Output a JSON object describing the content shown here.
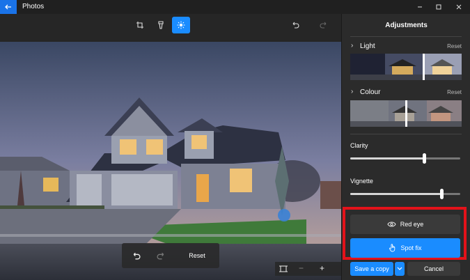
{
  "app": {
    "title": "Photos"
  },
  "overlay": {
    "reset_label": "Reset"
  },
  "panel": {
    "title": "Adjustments",
    "light": {
      "label": "Light",
      "reset": "Reset",
      "marker": 0.65
    },
    "colour": {
      "label": "Colour",
      "reset": "Reset",
      "marker": 0.5
    },
    "clarity": {
      "label": "Clarity",
      "value": 0.67
    },
    "vignette": {
      "label": "Vignette",
      "value": 0.83
    }
  },
  "actions": {
    "red_eye": "Red eye",
    "spot_fix": "Spot fix",
    "save": "Save a copy",
    "cancel": "Cancel"
  },
  "colors": {
    "accent": "#1a8cff",
    "highlight": "#e3121a",
    "panel_bg": "#2b2b2b"
  }
}
